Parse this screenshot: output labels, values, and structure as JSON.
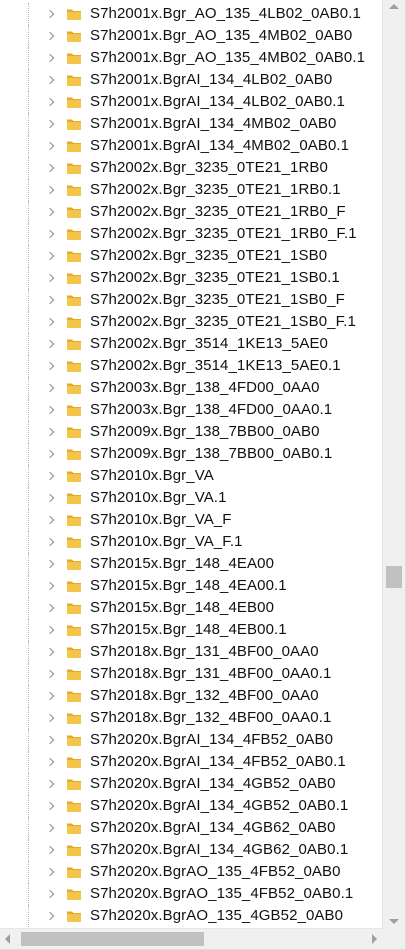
{
  "tree": {
    "items": [
      {
        "label": "S7h2001x.Bgr_AO_135_4LB02_0AB0.1"
      },
      {
        "label": "S7h2001x.Bgr_AO_135_4MB02_0AB0"
      },
      {
        "label": "S7h2001x.Bgr_AO_135_4MB02_0AB0.1"
      },
      {
        "label": "S7h2001x.BgrAI_134_4LB02_0AB0"
      },
      {
        "label": "S7h2001x.BgrAI_134_4LB02_0AB0.1"
      },
      {
        "label": "S7h2001x.BgrAI_134_4MB02_0AB0"
      },
      {
        "label": "S7h2001x.BgrAI_134_4MB02_0AB0.1"
      },
      {
        "label": "S7h2002x.Bgr_3235_0TE21_1RB0"
      },
      {
        "label": "S7h2002x.Bgr_3235_0TE21_1RB0.1"
      },
      {
        "label": "S7h2002x.Bgr_3235_0TE21_1RB0_F"
      },
      {
        "label": "S7h2002x.Bgr_3235_0TE21_1RB0_F.1"
      },
      {
        "label": "S7h2002x.Bgr_3235_0TE21_1SB0"
      },
      {
        "label": "S7h2002x.Bgr_3235_0TE21_1SB0.1"
      },
      {
        "label": "S7h2002x.Bgr_3235_0TE21_1SB0_F"
      },
      {
        "label": "S7h2002x.Bgr_3235_0TE21_1SB0_F.1"
      },
      {
        "label": "S7h2002x.Bgr_3514_1KE13_5AE0"
      },
      {
        "label": "S7h2002x.Bgr_3514_1KE13_5AE0.1"
      },
      {
        "label": "S7h2003x.Bgr_138_4FD00_0AA0"
      },
      {
        "label": "S7h2003x.Bgr_138_4FD00_0AA0.1"
      },
      {
        "label": "S7h2009x.Bgr_138_7BB00_0AB0"
      },
      {
        "label": "S7h2009x.Bgr_138_7BB00_0AB0.1"
      },
      {
        "label": "S7h2010x.Bgr_VA"
      },
      {
        "label": "S7h2010x.Bgr_VA.1"
      },
      {
        "label": "S7h2010x.Bgr_VA_F"
      },
      {
        "label": "S7h2010x.Bgr_VA_F.1"
      },
      {
        "label": "S7h2015x.Bgr_148_4EA00"
      },
      {
        "label": "S7h2015x.Bgr_148_4EA00.1"
      },
      {
        "label": "S7h2015x.Bgr_148_4EB00"
      },
      {
        "label": "S7h2015x.Bgr_148_4EB00.1"
      },
      {
        "label": "S7h2018x.Bgr_131_4BF00_0AA0"
      },
      {
        "label": "S7h2018x.Bgr_131_4BF00_0AA0.1"
      },
      {
        "label": "S7h2018x.Bgr_132_4BF00_0AA0"
      },
      {
        "label": "S7h2018x.Bgr_132_4BF00_0AA0.1"
      },
      {
        "label": "S7h2020x.BgrAI_134_4FB52_0AB0"
      },
      {
        "label": "S7h2020x.BgrAI_134_4FB52_0AB0.1"
      },
      {
        "label": "S7h2020x.BgrAI_134_4GB52_0AB0"
      },
      {
        "label": "S7h2020x.BgrAI_134_4GB52_0AB0.1"
      },
      {
        "label": "S7h2020x.BgrAI_134_4GB62_0AB0"
      },
      {
        "label": "S7h2020x.BgrAI_134_4GB62_0AB0.1"
      },
      {
        "label": "S7h2020x.BgrAO_135_4FB52_0AB0"
      },
      {
        "label": "S7h2020x.BgrAO_135_4FB52_0AB0.1"
      },
      {
        "label": "S7h2020x.BgrAO_135_4GB52_0AB0"
      }
    ]
  },
  "icons": {
    "expander": "chevron-right-icon",
    "item": "folder-icon",
    "scroll_up": "arrow-up-icon",
    "scroll_down": "arrow-down-icon",
    "scroll_left": "arrow-left-icon",
    "scroll_right": "arrow-right-icon"
  },
  "colors": {
    "folder": "#f3c64b",
    "folder_dark": "#e2ab2a",
    "text": "#111111",
    "scroll_thumb": "#c1c1c1"
  },
  "scrollbars": {
    "vertical_position": 0.63,
    "horizontal_position": 0.0
  }
}
